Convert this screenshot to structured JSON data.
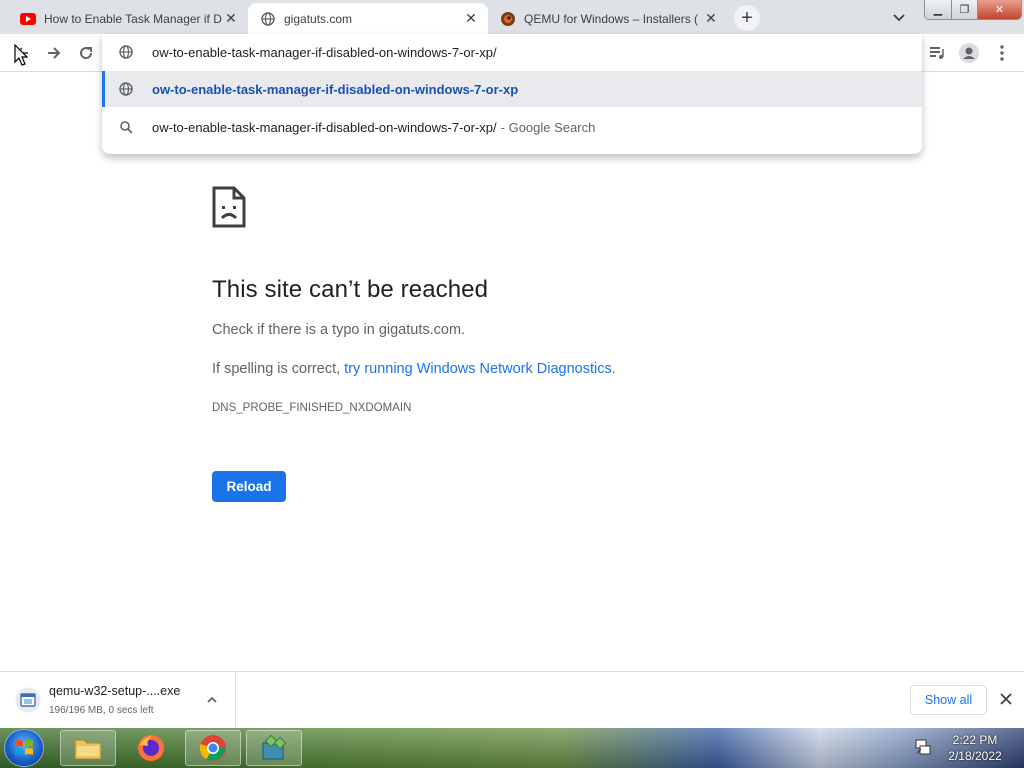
{
  "browser": {
    "tabs": [
      {
        "title": "How to Enable Task Manager if D",
        "favicon": "youtube-icon",
        "active": false
      },
      {
        "title": "gigatuts.com",
        "favicon": "globe-icon",
        "active": true
      },
      {
        "title": "QEMU for Windows – Installers (",
        "favicon": "qemu-icon",
        "active": false
      }
    ],
    "tab_close_glyph": "✕",
    "new_tab_glyph": "+",
    "window_controls": {
      "minimize": "▁",
      "restore": "❐",
      "close": "✕"
    }
  },
  "omnibox": {
    "input_value": "ow-to-enable-task-manager-if-disabled-on-windows-7-or-xp/",
    "suggestions": [
      {
        "text": "ow-to-enable-task-manager-if-disabled-on-windows-7-or-xp",
        "suffix": "",
        "icon": "globe-icon",
        "selected": true
      },
      {
        "text": "ow-to-enable-task-manager-if-disabled-on-windows-7-or-xp/",
        "suffix": "- Google Search",
        "icon": "search-icon",
        "selected": false
      }
    ]
  },
  "error_page": {
    "title": "This site can’t be reached",
    "line1": "Check if there is a typo in gigatuts.com.",
    "line2_prefix": "If spelling is correct, ",
    "line2_link": "try running Windows Network Diagnostics",
    "line2_suffix": ".",
    "error_code": "DNS_PROBE_FINISHED_NXDOMAIN",
    "reload_label": "Reload"
  },
  "download_shelf": {
    "file_name": "qemu-w32-setup-....exe",
    "status": "196/196 MB, 0 secs left",
    "show_all_label": "Show all"
  },
  "taskbar": {
    "time": "2:22 PM",
    "date": "2/18/2022"
  },
  "colors": {
    "accent": "#1a73e8",
    "tabstrip": "#dee1e6",
    "text_primary": "#202124",
    "text_secondary": "#5f6368"
  }
}
